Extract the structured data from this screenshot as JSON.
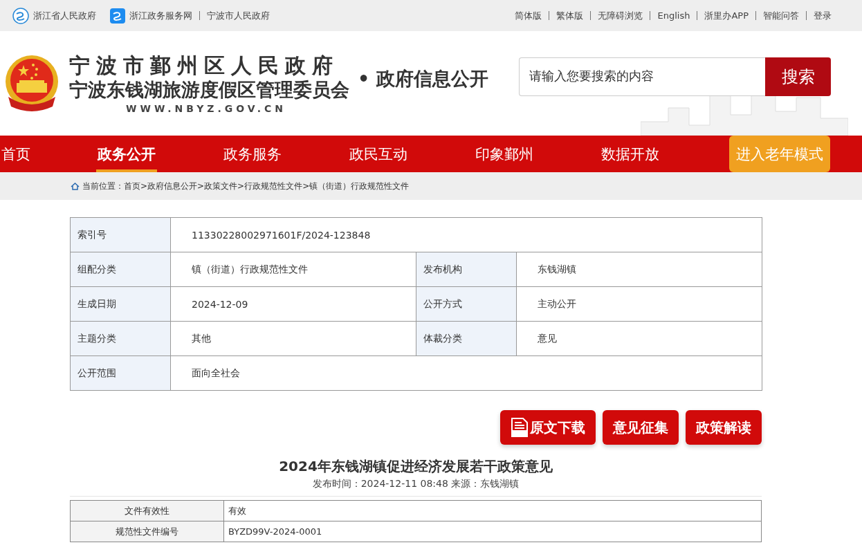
{
  "top_bar": {
    "left_links": [
      {
        "label": "浙江省人民政府",
        "kind": "icon-round"
      },
      {
        "label": "浙江政务服务网",
        "kind": "icon-square"
      },
      {
        "label": "宁波市人民政府",
        "kind": "plain"
      }
    ],
    "right_links": [
      "简体版",
      "繁体版",
      "无障碍浏览",
      "English",
      "浙里办APP",
      "智能问答",
      "登录"
    ]
  },
  "header": {
    "title_line_1": "宁波市鄞州区人民政府",
    "title_line_2": "宁波东钱湖旅游度假区管理委员会",
    "url": "WWW.NBYZ.GOV.CN",
    "section": "• 政府信息公开",
    "search": {
      "placeholder": "请输入您要搜索的内容",
      "button": "搜索"
    }
  },
  "nav": [
    {
      "label": "首页",
      "selected": false
    },
    {
      "label": "政务公开",
      "selected": true
    },
    {
      "label": "政务服务",
      "selected": false
    },
    {
      "label": "政民互动",
      "selected": false
    },
    {
      "label": "印象鄞州",
      "selected": false
    },
    {
      "label": "数据开放",
      "selected": false
    }
  ],
  "elder_mode_button": "进入老年模式",
  "breadcrumb": "当前位置：首页>政府信息公开>政策文件>行政规范性文件>镇（街道）行政规范性文件",
  "info_table": [
    [
      {
        "label": "索引号",
        "value": "11330228002971601F/2024-123848"
      }
    ],
    [
      {
        "label": "组配分类",
        "value": "镇（街道）行政规范性文件"
      },
      {
        "label": "发布机构",
        "value": "东钱湖镇"
      }
    ],
    [
      {
        "label": "生成日期",
        "value": "2024-12-09"
      },
      {
        "label": "公开方式",
        "value": "主动公开"
      }
    ],
    [
      {
        "label": "主题分类",
        "value": "其他"
      },
      {
        "label": "体裁分类",
        "value": "意见"
      }
    ],
    [
      {
        "label": "公开范围",
        "value": "面向全社会"
      }
    ]
  ],
  "actions": [
    {
      "label": "原文下载",
      "kind": "pdf"
    },
    {
      "label": "意见征集",
      "kind": "plain"
    },
    {
      "label": "政策解读",
      "kind": "plain"
    }
  ],
  "article": {
    "title": "2024年东钱湖镇促进经济发展若干政策意见",
    "meta": "发布时间：2024-12-11 08:48 来源：东钱湖镇"
  },
  "doc_table": [
    {
      "label": "文件有效性",
      "value": "有效"
    },
    {
      "label": "规范性文件编号",
      "value": "BYZD99V-2024-0001"
    }
  ]
}
